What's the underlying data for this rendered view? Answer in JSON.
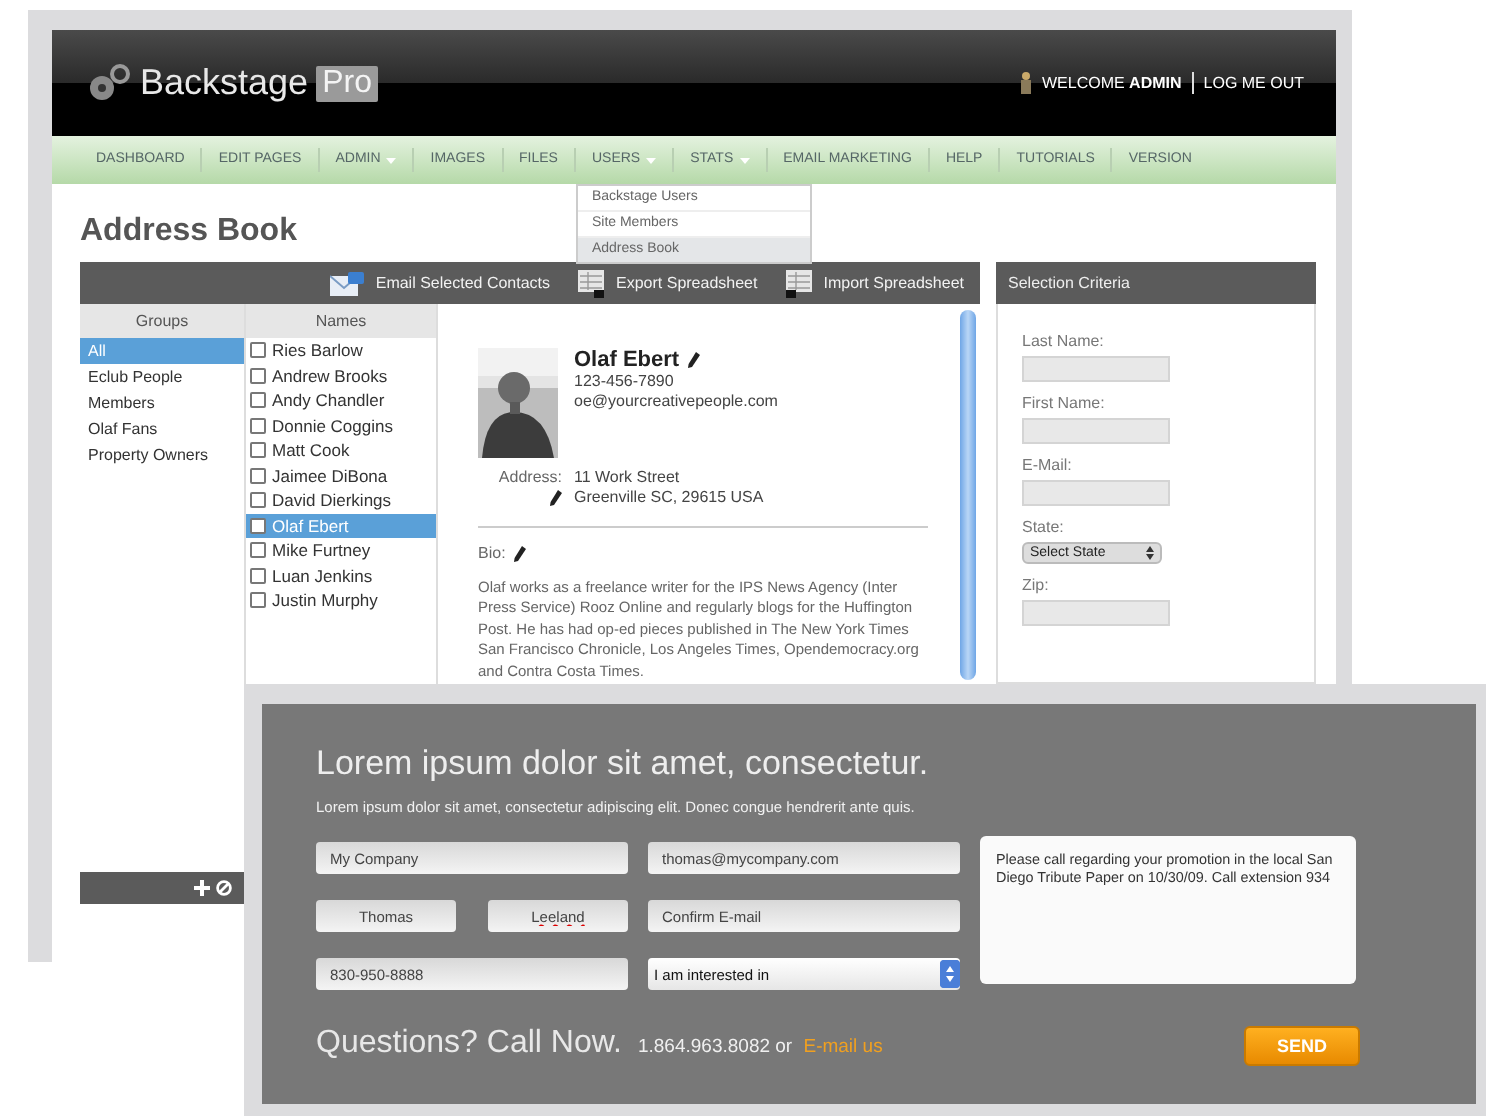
{
  "back_window": {
    "logo": {
      "name": "Backstage",
      "badge": "Pro"
    },
    "user_bar": {
      "welcome": "WELCOME **ADMIN**",
      "logout": "LOG ME OUT"
    },
    "nav": [
      {
        "label": "DASHBOARD",
        "has_menu": false
      },
      {
        "label": "EDIT PAGES",
        "has_menu": false
      },
      {
        "label": "ADMIN",
        "has_menu": true
      },
      {
        "label": "IMAGES",
        "has_menu": false
      },
      {
        "label": "FILES",
        "has_menu": false
      },
      {
        "label": "USERS",
        "has_menu": true,
        "menu": [
          {
            "label": "Backstage Users",
            "selected": false
          },
          {
            "label": "Site Members",
            "selected": false
          },
          {
            "label": "Address Book",
            "selected": true
          }
        ]
      },
      {
        "label": "STATS",
        "has_menu": true
      },
      {
        "label": "EMAIL MARKETING",
        "has_menu": false
      },
      {
        "label": "HELP",
        "has_menu": false
      },
      {
        "label": "TUTORIALS",
        "has_menu": false
      },
      {
        "label": "VERSION",
        "has_menu": false
      }
    ],
    "page_title": "Address Book",
    "toolbar": [
      {
        "label": "Email Selected Contacts",
        "kind": "email"
      },
      {
        "label": "Export Spreadsheet",
        "kind": "export"
      },
      {
        "label": "Import Spreadsheet",
        "kind": "import"
      }
    ],
    "groups": {
      "heading": "Groups",
      "items": [
        {
          "label": "All",
          "selected": true
        },
        {
          "label": "Eclub People",
          "selected": false
        },
        {
          "label": "Members",
          "selected": false
        },
        {
          "label": "Olaf Fans",
          "selected": false
        },
        {
          "label": "Property Owners",
          "selected": false
        }
      ]
    },
    "names": {
      "heading": "Names",
      "items": [
        {
          "label": "Ries Barlow",
          "checked": false,
          "selected": false
        },
        {
          "label": "Andrew Brooks",
          "checked": false,
          "selected": false
        },
        {
          "label": "Andy Chandler",
          "checked": false,
          "selected": false
        },
        {
          "label": "Donnie Coggins",
          "checked": false,
          "selected": false
        },
        {
          "label": "Matt Cook",
          "checked": false,
          "selected": false
        },
        {
          "label": "Jaimee DiBona",
          "checked": false,
          "selected": false
        },
        {
          "label": "David Dierkings",
          "checked": false,
          "selected": false
        },
        {
          "label": "Olaf Ebert",
          "checked": false,
          "selected": true
        },
        {
          "label": "Mike Furtney",
          "checked": false,
          "selected": false
        },
        {
          "label": "Luan Jenkins",
          "checked": false,
          "selected": false
        },
        {
          "label": "Justin Murphy",
          "checked": false,
          "selected": false
        }
      ]
    },
    "contact": {
      "name": "Olaf Ebert",
      "phone": "123-456-7890",
      "email": "oe@yourcreativepeople.com",
      "address_label": "Address:",
      "address_lines": [
        "11 Work Street",
        "Greenville SC, 29615 USA"
      ],
      "bio_label": "Bio:",
      "bio": "Olaf works as a freelance writer for the IPS News Agency (Inter Press Service) Rooz Online and regularly blogs for the Huffington Post. He has had op-ed pieces published in The New York Times San Francisco Chronicle, Los Angeles Times, Opendemocracy.org and Contra Costa Times."
    },
    "criteria": {
      "title": "Selection Criteria",
      "fields": [
        {
          "label": "Last Name:",
          "kind": "text"
        },
        {
          "label": "First Name:",
          "kind": "text"
        },
        {
          "label": "E-Mail:",
          "kind": "text"
        },
        {
          "label": "State:",
          "kind": "select",
          "value": "Select State"
        },
        {
          "label": "Zip:",
          "kind": "text"
        }
      ]
    }
  },
  "front_panel": {
    "heading": "Lorem ipsum dolor sit amet, consectetur.",
    "subheading": "Lorem ipsum dolor sit amet, consectetur adipiscing elit. Donec congue hendrerit ante quis.",
    "form": {
      "company": "My Company",
      "email": "thomas@mycompany.com",
      "first_name": "Thomas",
      "last_name": "Leeland",
      "confirm_email": {
        "placeholder": "Confirm E-mail"
      },
      "phone": "830-950-8888",
      "interest": "I am interested in",
      "message": "Please call regarding your promotion in the local San Diego Tribute Paper on 10/30/09. Call extension 934"
    },
    "call_title": "Questions? Call Now.",
    "contact_line": {
      "text": "1.864.963.8082 or",
      "link": "E-mail us"
    },
    "send_button": "SEND"
  }
}
